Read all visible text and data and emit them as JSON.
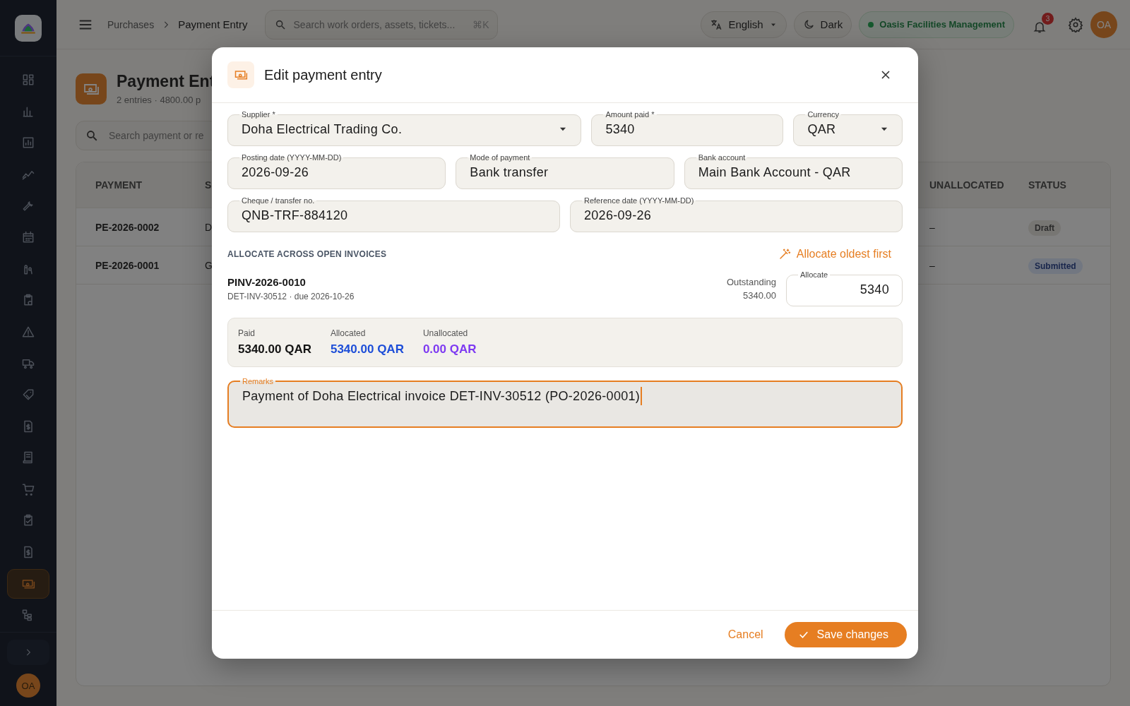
{
  "topbar": {
    "breadcrumb": [
      "Purchases",
      "Payment Entry"
    ],
    "search": {
      "placeholder": "Search work orders, assets, tickets...",
      "shortcut": "⌘K"
    },
    "language": "English",
    "theme": "Dark",
    "organization": "Oasis Facilities Management",
    "notifications": "3",
    "avatar": "OA"
  },
  "sidebar": {
    "items": [
      {
        "selected": false
      },
      {
        "selected": false
      },
      {
        "selected": false
      },
      {
        "selected": false
      },
      {
        "selected": false
      },
      {
        "selected": false
      },
      {
        "selected": false
      },
      {
        "selected": false
      },
      {
        "selected": false
      },
      {
        "selected": false
      },
      {
        "selected": false
      },
      {
        "selected": false
      },
      {
        "selected": false
      },
      {
        "selected": false
      },
      {
        "selected": false
      },
      {
        "selected": false
      },
      {
        "selected": true
      },
      {
        "selected": false
      }
    ],
    "user": "OA"
  },
  "page": {
    "title": "Payment Ent",
    "subtitle": "2 entries · 4800.00 p",
    "search": {
      "placeholder": "Search payment or re"
    },
    "table": {
      "columns": [
        "PAYMENT",
        "S",
        "UNALLOCATED",
        "STATUS"
      ],
      "rows": [
        {
          "payment": "PE-2026-0002",
          "column_2": "D",
          "unallocated": "–",
          "status": "Draft",
          "kind": "draft"
        },
        {
          "payment": "PE-2026-0001",
          "column_2": "G",
          "unallocated": "–",
          "status": "Submitted",
          "kind": "submitted"
        }
      ]
    }
  },
  "dialog": {
    "title": "Edit payment entry",
    "field_rows": [
      {
        "fields": [
          {
            "label": "Supplier *",
            "value": "Doha Electrical Trading Co.",
            "kind": "select"
          },
          {
            "label": "Amount paid *",
            "value": "5340",
            "kind": "text"
          },
          {
            "label": "Currency",
            "value": "QAR",
            "kind": "select"
          }
        ]
      },
      {
        "fields": [
          {
            "label": "Posting date (YYYY-MM-DD)",
            "value": "2026-09-26",
            "kind": "text"
          },
          {
            "label": "Mode of payment",
            "value": "Bank transfer",
            "kind": "text"
          },
          {
            "label": "Bank account",
            "value": "Main Bank Account - QAR",
            "kind": "text"
          }
        ]
      },
      {
        "fields": [
          {
            "label": "Cheque / transfer no.",
            "value": "QNB-TRF-884120",
            "kind": "text"
          },
          {
            "label": "Reference date (YYYY-MM-DD)",
            "value": "2026-09-26",
            "kind": "text"
          }
        ]
      }
    ],
    "allocation": {
      "heading": "ALLOCATE ACROSS OPEN INVOICES",
      "auto_button": "Allocate oldest first",
      "invoices": [
        {
          "number": "PINV-2026-0010",
          "detail": "DET-INV-30512 · due 2026-10-26",
          "outstanding_label": "Outstanding",
          "outstanding": "5340.00",
          "allocate_label": "Allocate",
          "allocate": "5340"
        }
      ]
    },
    "summary": [
      {
        "label": "Paid",
        "value": "5340.00 QAR",
        "kind": "paid"
      },
      {
        "label": "Allocated",
        "value": "5340.00 QAR",
        "kind": "allocated"
      },
      {
        "label": "Unallocated",
        "value": "0.00 QAR",
        "kind": "unallocated"
      }
    ],
    "remarks": {
      "label": "Remarks",
      "value": "Payment of Doha Electrical invoice DET-INV-30512 (PO-2026-0001)",
      "focused": true
    },
    "cancel": "Cancel",
    "save": "Save changes"
  }
}
